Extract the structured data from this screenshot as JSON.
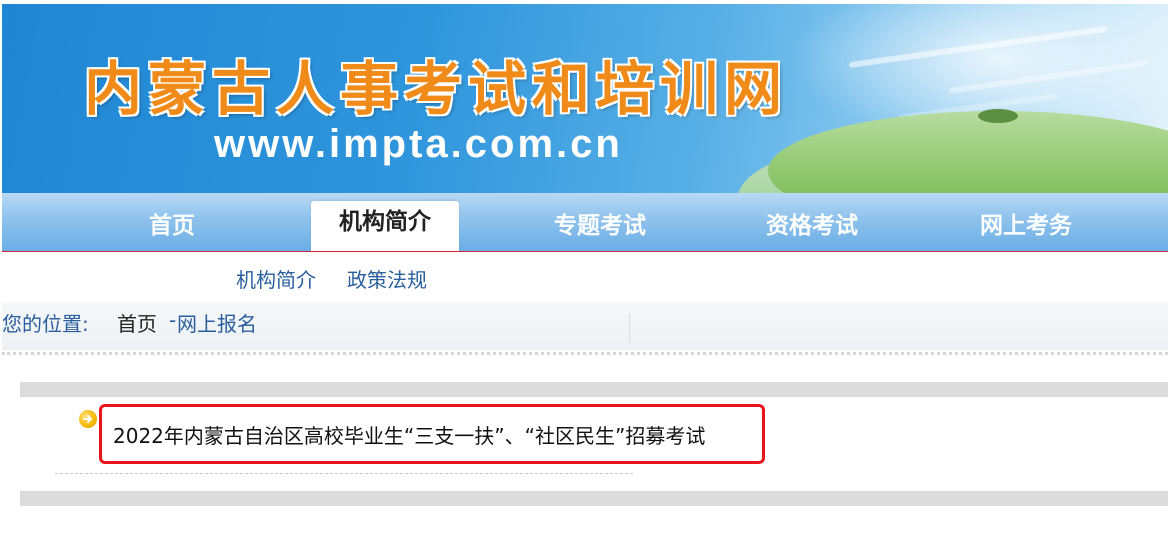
{
  "banner": {
    "site_title": "内蒙古人事考试和培训网",
    "site_url": "www.impta.com.cn"
  },
  "main_nav": {
    "items": [
      {
        "label": "首页"
      },
      {
        "label": "机构简介",
        "active": true
      },
      {
        "label": "专题考试"
      },
      {
        "label": "资格考试"
      },
      {
        "label": "网上考务"
      }
    ]
  },
  "sub_nav": {
    "items": [
      {
        "label": "机构简介"
      },
      {
        "label": "政策法规"
      }
    ]
  },
  "breadcrumb": {
    "label": "您的位置:",
    "home": "首页",
    "separator": "-",
    "current": "网上报名"
  },
  "notices": [
    {
      "title": "2022年内蒙古自治区高校毕业生“三支一扶”、“社区民生”招募考试",
      "icon": "arrow-right-icon"
    }
  ],
  "colors": {
    "title_orange": "#f08a18",
    "nav_blue": "#6aaee6",
    "link_blue": "#2a5f9e",
    "highlight_red": "#e8141c"
  }
}
